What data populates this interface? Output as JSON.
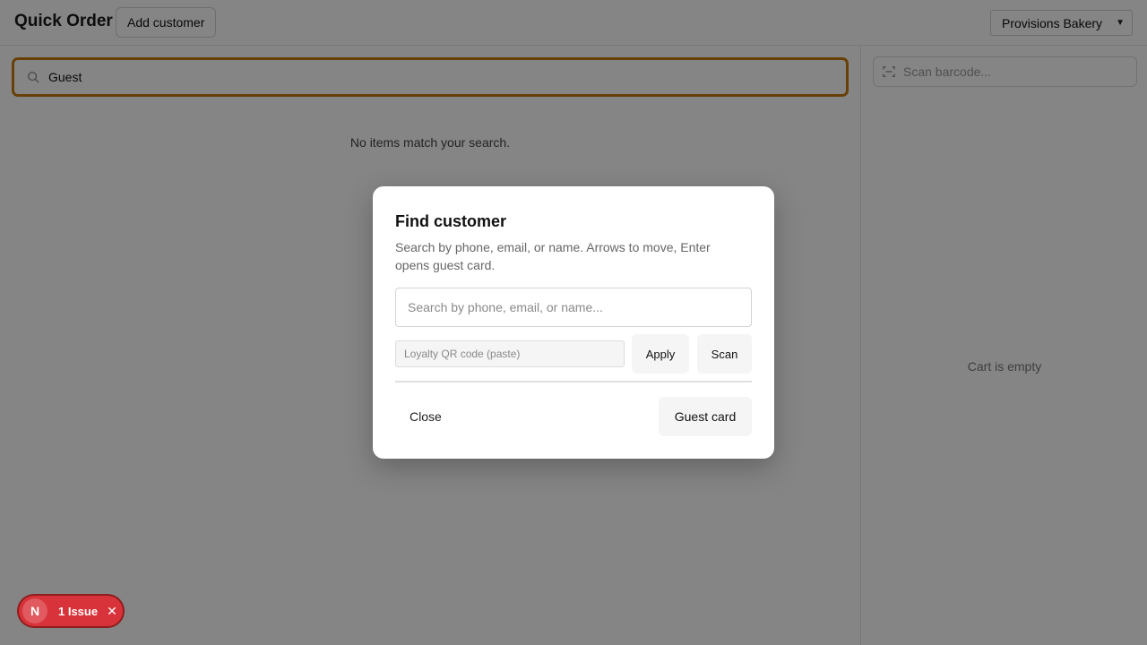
{
  "header": {
    "title": "Quick Order",
    "add_customer_label": "Add customer",
    "store_select_value": "Provisions Bakery"
  },
  "main": {
    "search_value": "Guest",
    "empty_message": "No items match your search."
  },
  "cart": {
    "barcode_placeholder": "Scan barcode...",
    "empty_message": "Cart is empty"
  },
  "dialog": {
    "title": "Find customer",
    "description": "Search by phone, email, or name. Arrows to move, Enter opens guest card.",
    "search_placeholder": "Search by phone, email, or name...",
    "loyalty_placeholder": "Loyalty QR code (paste)",
    "apply_label": "Apply",
    "scan_label": "Scan",
    "close_label": "Close",
    "guest_card_label": "Guest card"
  },
  "issue_badge": {
    "logo_letter": "N",
    "label": "1 Issue",
    "close_glyph": "✕"
  },
  "colors": {
    "search_focus": "#c77c0f",
    "issue_badge": "#d8333a"
  }
}
